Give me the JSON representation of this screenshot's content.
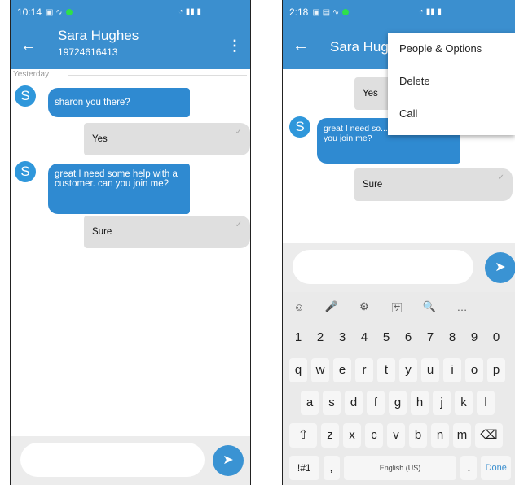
{
  "left": {
    "status": {
      "time": "10:14"
    },
    "header": {
      "name": "Sara Hughes",
      "phone": "19724616413"
    },
    "day_label": "Yesterday",
    "messages": [
      {
        "from": "S",
        "text": "sharon you there?"
      },
      {
        "text": "Yes"
      },
      {
        "from": "S",
        "text": "great I need some help with a customer. can you join me?"
      },
      {
        "text": "Sure"
      }
    ]
  },
  "right": {
    "status": {
      "time": "2:18"
    },
    "header": {
      "name": "Sara Hugh"
    },
    "menu": [
      "People & Options",
      "Delete",
      "Call"
    ],
    "messages": [
      {
        "text": "Yes"
      },
      {
        "from": "S",
        "text": "great I need so... a customer. can you join me?"
      },
      {
        "text": "Sure"
      }
    ],
    "keyboard": {
      "numbers": [
        "1",
        "2",
        "3",
        "4",
        "5",
        "6",
        "7",
        "8",
        "9",
        "0"
      ],
      "row1": [
        "q",
        "w",
        "e",
        "r",
        "t",
        "y",
        "u",
        "i",
        "o",
        "p"
      ],
      "row2": [
        "a",
        "s",
        "d",
        "f",
        "g",
        "h",
        "j",
        "k",
        "l"
      ],
      "row3": [
        "z",
        "x",
        "c",
        "v",
        "b",
        "n",
        "m"
      ],
      "symbols_key": "!#1",
      "comma": ",",
      "space_label": "English (US)",
      "period": ".",
      "done": "Done"
    }
  },
  "icons": {
    "back": "←",
    "more": "⋮",
    "send": "➤",
    "check": "✓",
    "tools": [
      "☺",
      "🎤",
      "⚙",
      "🈂",
      "🔍",
      "…"
    ],
    "shift": "⇧",
    "backspace": "⌫"
  },
  "colors": {
    "brand": "#3b8fcf",
    "incoming": "#2f8ad1",
    "outgoing": "#dfdfdf"
  }
}
